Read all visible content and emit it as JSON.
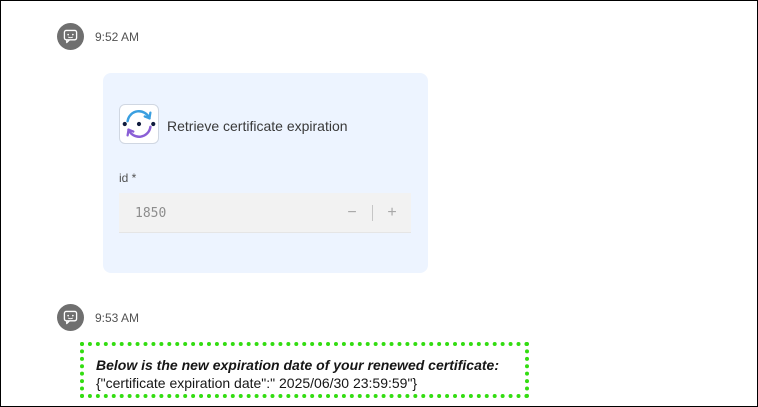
{
  "messages": [
    {
      "timestamp": "9:52 AM"
    },
    {
      "timestamp": "9:53 AM"
    }
  ],
  "tool_card": {
    "title": "Retrieve certificate expiration",
    "logo_icon": "sync-arrows-icon",
    "field": {
      "label": "id *",
      "value": "1850",
      "decrement": "−",
      "increment": "+"
    }
  },
  "response": {
    "heading": "Below is the new expiration date of your renewed certificate:",
    "body": "{\"certificate expiration date\":\" 2025/06/30 23:59:59\"}"
  },
  "colors": {
    "card_background": "#edf4ff",
    "avatar": "#6f6f6f",
    "highlight_border": "#33dd11"
  }
}
